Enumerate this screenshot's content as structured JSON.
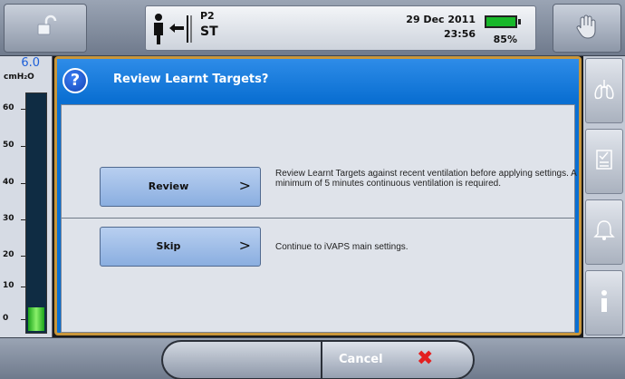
{
  "status_bar": {
    "mode_line1": "P2",
    "mode_line2": "ST",
    "date": "29 Dec 2011",
    "time": "23:56",
    "battery_percent": "85%"
  },
  "pressure": {
    "value": "6.0",
    "unit": "cmH₂O",
    "scale": [
      "60",
      "50",
      "40",
      "30",
      "20",
      "10",
      "0"
    ],
    "level_fraction": 0.1
  },
  "dialog": {
    "title": "Review Learnt Targets?",
    "options": [
      {
        "label": "Review",
        "chevron": ">",
        "description": "Review Learnt Targets against recent ventilation before applying settings. A minimum of 5 minutes continuous ventilation is required."
      },
      {
        "label": "Skip",
        "chevron": ">",
        "description": "Continue to iVAPS main settings."
      }
    ]
  },
  "bottom_bar": {
    "cancel_label": "Cancel"
  },
  "icons": {
    "lock": "unlock-icon",
    "hand": "hand-icon",
    "person": "patient-interface-icon",
    "battery": "battery-icon",
    "question": "question-icon",
    "lungs": "lungs-icon",
    "checklist": "checklist-icon",
    "alarm": "alarm-bell-icon",
    "info": "info-icon",
    "cancel_x": "red-x-icon"
  },
  "colors": {
    "dialog_blue": "#0a6fd2",
    "dialog_border": "#c9963a",
    "pressure_value": "#1d5fd8",
    "battery_green": "#18b82a",
    "cancel_x": "#e32020"
  }
}
